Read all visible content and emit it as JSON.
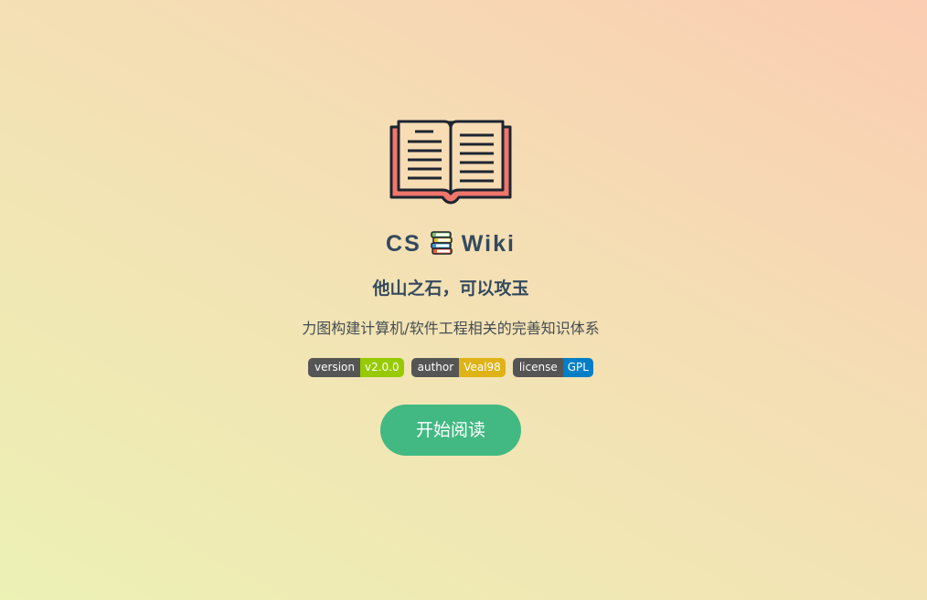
{
  "cover": {
    "title_left": "CS",
    "title_right": "Wiki",
    "tagline": "他山之石，可以攻玉",
    "description": "力图构建计算机/软件工程相关的完善知识体系",
    "badges": [
      {
        "key": "version",
        "value": "v2.0.0",
        "color": "#97ca00"
      },
      {
        "key": "author",
        "value": "Veal98",
        "color": "#dfb317"
      },
      {
        "key": "license",
        "value": "GPL",
        "color": "#007ec6"
      }
    ],
    "start_button": "开始阅读",
    "logo_icon": "open-book-icon",
    "title_icon": "books-stack-icon"
  },
  "colors": {
    "accent": "#42b983",
    "text": "#34495e",
    "book_cover": "#f0766c",
    "book_page": "#f7dcb4",
    "outline": "#1d2530"
  }
}
